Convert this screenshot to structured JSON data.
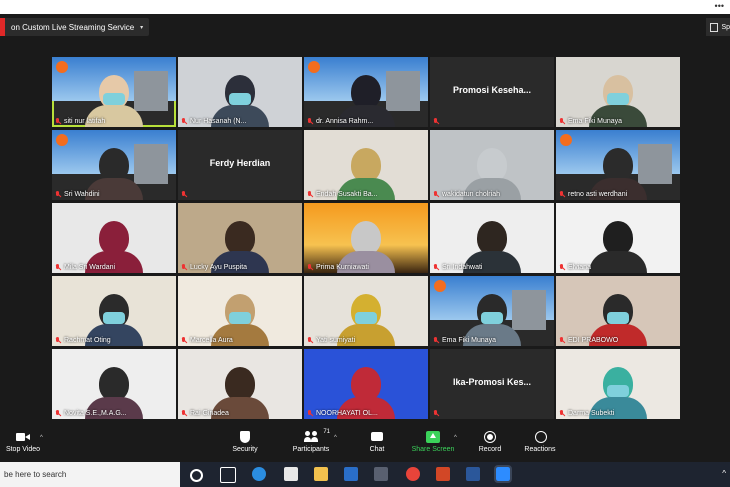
{
  "topbar": {
    "menu_dots": "•••"
  },
  "live": {
    "label": "on Custom Live Streaming Service",
    "caret": "▾"
  },
  "view": {
    "speaker_label": "Sp"
  },
  "tiles": [
    {
      "name": "siti nur latifah",
      "kind": "video",
      "active": true
    },
    {
      "name": "Nur Hasanah (N...",
      "kind": "video"
    },
    {
      "name": "dr. Annisa Rahm...",
      "kind": "video"
    },
    {
      "name": "Promosi  Keseha...",
      "kind": "text"
    },
    {
      "name": "Ema Fiki Munaya",
      "kind": "video"
    },
    {
      "name": "Sri Wahdini",
      "kind": "video"
    },
    {
      "name": "Ferdy Herdian",
      "kind": "text"
    },
    {
      "name": "Endah Susakti Ba...",
      "kind": "video"
    },
    {
      "name": "wakidatun cholriah",
      "kind": "video"
    },
    {
      "name": "retno asti werdhani",
      "kind": "video"
    },
    {
      "name": "Mila Sri Wardani",
      "kind": "video"
    },
    {
      "name": "Lucky Ayu Puspita",
      "kind": "video"
    },
    {
      "name": "Prima Kurniawati",
      "kind": "video"
    },
    {
      "name": "Sri Indahwati",
      "kind": "video"
    },
    {
      "name": "Elviana",
      "kind": "video"
    },
    {
      "name": "Rachmat Oting",
      "kind": "video"
    },
    {
      "name": "Marcella Aura",
      "kind": "video"
    },
    {
      "name": "Yati sumiyati",
      "kind": "video"
    },
    {
      "name": "Ema Fiki Munaya",
      "kind": "video"
    },
    {
      "name": "EDI PRABOWO",
      "kind": "video"
    },
    {
      "name": "Novita S.E.,M.A.G...",
      "kind": "video"
    },
    {
      "name": "Rai Ginadea",
      "kind": "video"
    },
    {
      "name": "NOORHAYATI OL...",
      "kind": "video"
    },
    {
      "name": "Ika-Promosi  Kes...",
      "kind": "text"
    },
    {
      "name": "Darma Subekti",
      "kind": "video"
    }
  ],
  "toolbar": {
    "stop_video": "Stop Video",
    "security": "Security",
    "participants": "Participants",
    "participants_count": "71",
    "chat": "Chat",
    "share_screen": "Share Screen",
    "record": "Record",
    "reactions": "Reactions"
  },
  "taskbar": {
    "search_placeholder": "be here to search",
    "tray_text": "^"
  },
  "colors": {
    "accent_green": "#3bd25a",
    "active_border": "#b8e03a",
    "live_red": "#e02828"
  }
}
